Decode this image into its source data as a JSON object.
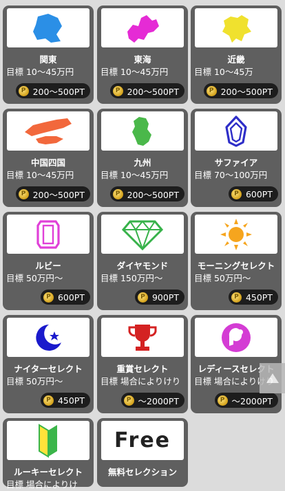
{
  "colors": {
    "card": "#5f5f5f",
    "pill": "#1d1d1d",
    "coin": "#e0b830",
    "kanto": "#2b8fe6",
    "tokai": "#e52bd5",
    "kinki": "#f0e12e",
    "chugoku": "#f2683c",
    "kyushu": "#4ab84a",
    "sapphire": "#2e2ec8",
    "ruby": "#e040d8",
    "emerald": "#37b24a",
    "morning": "#f6a51e",
    "nighter": "#1a1acc",
    "trophy": "#d42222",
    "ladies": "#d43cd4",
    "rookie": "#3bb54a"
  },
  "cards": [
    {
      "title": "関東",
      "target": "目標 10〜45万円",
      "points": "200〜500PT",
      "icon": "kanto-map-icon"
    },
    {
      "title": "東海",
      "target": "目標 10〜45万円",
      "points": "200〜500PT",
      "icon": "tokai-map-icon"
    },
    {
      "title": "近畿",
      "target": "目標 10〜45万",
      "points": "200〜500PT",
      "icon": "kinki-map-icon"
    },
    {
      "title": "中国四国",
      "target": "目標 10〜45万円",
      "points": "200〜500PT",
      "icon": "chugoku-shikoku-map-icon"
    },
    {
      "title": "九州",
      "target": "目標 10〜45万円",
      "points": "200〜500PT",
      "icon": "kyushu-map-icon"
    },
    {
      "title": "サファイア",
      "target": "目標 70〜100万円",
      "points": "600PT",
      "icon": "sapphire-gem-icon"
    },
    {
      "title": "ルビー",
      "target": "目標 50万円〜",
      "points": "600PT",
      "icon": "ruby-gem-icon"
    },
    {
      "title": "ダイヤモンド",
      "target": "目標 150万円〜",
      "points": "900PT",
      "icon": "diamond-icon"
    },
    {
      "title": "モーニングセレクト",
      "target": "目標 50万円〜",
      "points": "450PT",
      "icon": "sun-icon"
    },
    {
      "title": "ナイターセレクト",
      "target": "目標 50万円〜",
      "points": "450PT",
      "icon": "moon-star-icon"
    },
    {
      "title": "重賞セレクト",
      "target": "目標 場合によりけり",
      "points": "〜2000PT",
      "icon": "trophy-icon"
    },
    {
      "title": "レディースセレクト",
      "target": "目標 場合によりけり",
      "points": "〜2000PT",
      "icon": "lady-icon"
    },
    {
      "title": "ルーキーセレクト",
      "target": "目標 場合によりけ",
      "points": "",
      "icon": "beginner-mark-icon"
    },
    {
      "title": "無料セレクション",
      "target": "",
      "points": "",
      "icon": "free-icon",
      "icon_text": "Free"
    }
  ],
  "coin_symbol": "P",
  "scroll_top_icon": "arrow-up-icon"
}
